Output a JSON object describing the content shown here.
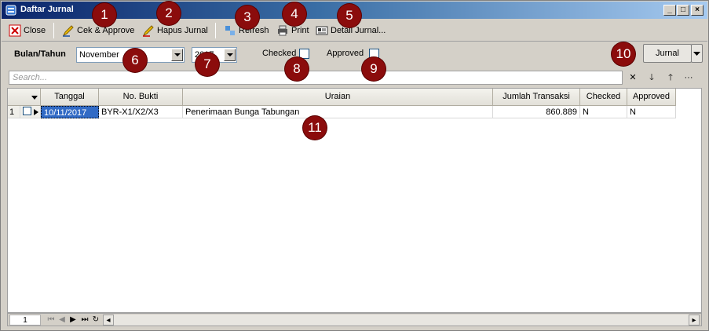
{
  "window": {
    "title": "Daftar Jurnal"
  },
  "toolbar": {
    "close": "Close",
    "cek_approve": "Cek & Approve",
    "hapus_jurnal": "Hapus Jurnal",
    "refresh": "Refresh",
    "print": "Print",
    "detail_jurnal": "Detail Jurnal..."
  },
  "filter": {
    "period_label": "Bulan/Tahun",
    "month_value": "November",
    "year_value": "2017",
    "checked_label": "Checked",
    "approved_label": "Approved",
    "jurnal_button": "Jurnal"
  },
  "search": {
    "placeholder": "Search..."
  },
  "grid": {
    "columns": [
      "Tanggal",
      "No. Bukti",
      "Uraian",
      "Jumlah Transaksi",
      "Checked",
      "Approved"
    ],
    "rows": [
      {
        "row_no": "1",
        "tanggal": "10/11/2017",
        "no_bukti": "BYR-X1/X2/X3",
        "uraian": "Penerimaan Bunga Tabungan",
        "jumlah": "860.889",
        "checked": "N",
        "approved": "N"
      }
    ]
  },
  "pager": {
    "page": "1"
  },
  "badges": [
    "1",
    "2",
    "3",
    "4",
    "5",
    "6",
    "7",
    "8",
    "9",
    "10",
    "11"
  ],
  "colors": {
    "badge": "#8b0c0c",
    "title_start": "#0a246a",
    "title_end": "#a6caf0",
    "selected_cell": "#316ac5"
  }
}
